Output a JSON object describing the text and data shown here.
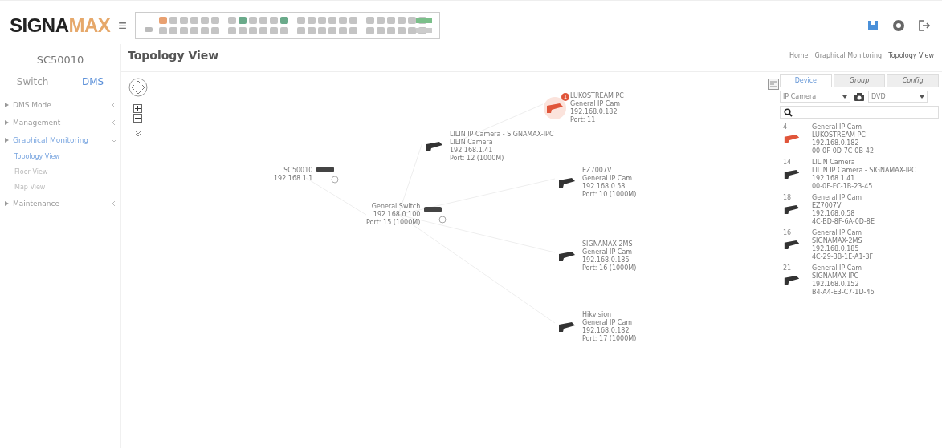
{
  "header": {
    "logo_dark": "SIGNA",
    "logo_light": "MAX",
    "menu_icon": "≡"
  },
  "sidebar": {
    "device": "SC50010",
    "tabs": [
      {
        "label": "Switch",
        "selected": false
      },
      {
        "label": "DMS",
        "selected": true
      }
    ],
    "items": [
      {
        "label": "DMS Mode",
        "expanded": false,
        "selected": false
      },
      {
        "label": "Management",
        "expanded": false,
        "selected": false
      },
      {
        "label": "Graphical Monitoring",
        "expanded": true,
        "selected": true,
        "children": [
          {
            "label": "Topology View",
            "selected": true
          },
          {
            "label": "Floor View",
            "selected": false
          },
          {
            "label": "Map View",
            "selected": false
          }
        ]
      },
      {
        "label": "Maintenance",
        "expanded": false,
        "selected": false
      }
    ]
  },
  "page": {
    "title": "Topology View",
    "breadcrumb": [
      "Home",
      "Graphical Monitoring",
      "Topology View"
    ]
  },
  "topology": {
    "nodes": [
      {
        "kind": "switch",
        "lines": [
          "SC50010",
          "192.168.1.1"
        ]
      },
      {
        "kind": "switch",
        "lines": [
          "General Switch",
          "192.168.0.100",
          "Port: 15 (1000M)"
        ]
      },
      {
        "kind": "camera",
        "alert": false,
        "lines": [
          "LILIN IP Camera - SIGNAMAX-IPC",
          "LILIN Camera",
          "192.168.1.41",
          "Port: 12 (1000M)"
        ]
      },
      {
        "kind": "camera",
        "alert": true,
        "badge": "1",
        "lines": [
          "LUKOSTREAM PC",
          "General IP Cam",
          "192.168.0.182",
          "Port: 11"
        ]
      },
      {
        "kind": "camera",
        "alert": false,
        "lines": [
          "EZ7007V",
          "General IP Cam",
          "192.168.0.58",
          "Port: 10 (1000M)"
        ]
      },
      {
        "kind": "camera",
        "alert": false,
        "lines": [
          "SIGNAMAX-2MS",
          "General IP Cam",
          "192.168.0.185",
          "Port: 16 (1000M)"
        ]
      },
      {
        "kind": "camera",
        "alert": false,
        "lines": [
          "Hikvision",
          "General IP Cam",
          "192.168.0.182",
          "Port: 17 (1000M)"
        ]
      }
    ]
  },
  "panel": {
    "tabs": [
      {
        "label": "Device",
        "selected": true
      },
      {
        "label": "Group",
        "selected": false
      },
      {
        "label": "Config",
        "selected": false
      }
    ],
    "type_select": "IP Camera",
    "second_select": "DVD",
    "devices": [
      {
        "port": "4",
        "alert": true,
        "lines": [
          "General IP Cam",
          "LUKOSTREAM PC",
          "192.168.0.182",
          "00-0F-0D-7C-0B-42"
        ]
      },
      {
        "port": "14",
        "alert": false,
        "lines": [
          "LILIN Camera",
          "LILIN IP Camera - SIGNAMAX-IPC",
          "192.168.1.41",
          "00-0F-FC-1B-23-45"
        ]
      },
      {
        "port": "18",
        "alert": false,
        "lines": [
          "General IP Cam",
          "EZ7007V",
          "192.168.0.58",
          "4C-BD-8F-6A-0D-8E"
        ]
      },
      {
        "port": "16",
        "alert": false,
        "lines": [
          "General IP Cam",
          "SIGNAMAX-2MS",
          "192.168.0.185",
          "4C-29-3B-1E-A1-3F"
        ]
      },
      {
        "port": "21",
        "alert": false,
        "lines": [
          "General IP Cam",
          "SIGNAMAX-IPC",
          "192.168.0.152",
          "B4-A4-E3-C7-1D-46"
        ]
      }
    ]
  }
}
